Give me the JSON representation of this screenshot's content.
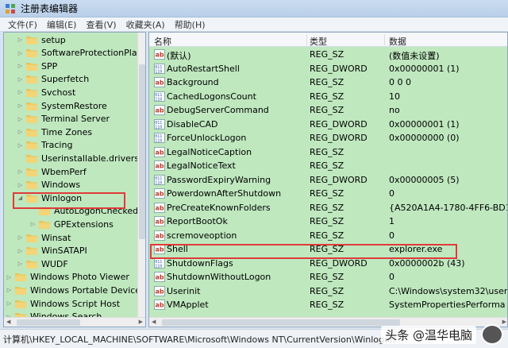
{
  "window": {
    "title": "注册表编辑器"
  },
  "menu": [
    "文件(F)",
    "编辑(E)",
    "查看(V)",
    "收藏夹(A)",
    "帮助(H)"
  ],
  "tree": {
    "items": [
      {
        "label": "setup",
        "indent": 1,
        "expander": "▷"
      },
      {
        "label": "SoftwareProtectionPlatform",
        "indent": 1,
        "expander": "▷"
      },
      {
        "label": "SPP",
        "indent": 1,
        "expander": "▷"
      },
      {
        "label": "Superfetch",
        "indent": 1,
        "expander": "▷"
      },
      {
        "label": "Svchost",
        "indent": 1,
        "expander": "▷"
      },
      {
        "label": "SystemRestore",
        "indent": 1,
        "expander": "▷"
      },
      {
        "label": "Terminal Server",
        "indent": 1,
        "expander": "▷"
      },
      {
        "label": "Time Zones",
        "indent": 1,
        "expander": "▷"
      },
      {
        "label": "Tracing",
        "indent": 1,
        "expander": "▷"
      },
      {
        "label": "Userinstallable.drivers",
        "indent": 1,
        "expander": ""
      },
      {
        "label": "WbemPerf",
        "indent": 1,
        "expander": "▷"
      },
      {
        "label": "Windows",
        "indent": 1,
        "expander": "▷"
      },
      {
        "label": "Winlogon",
        "indent": 1,
        "expander": "◢"
      },
      {
        "label": "AutoLogonChecked",
        "indent": 2,
        "expander": ""
      },
      {
        "label": "GPExtensions",
        "indent": 2,
        "expander": "▷"
      },
      {
        "label": "Winsat",
        "indent": 1,
        "expander": "▷"
      },
      {
        "label": "WinSATAPI",
        "indent": 1,
        "expander": "▷"
      },
      {
        "label": "WUDF",
        "indent": 1,
        "expander": "▷"
      },
      {
        "label": "Windows Photo Viewer",
        "indent": 0,
        "expander": "▷"
      },
      {
        "label": "Windows Portable Devices",
        "indent": 0,
        "expander": "▷"
      },
      {
        "label": "Windows Script Host",
        "indent": 0,
        "expander": "▷"
      },
      {
        "label": "Windows Search",
        "indent": 0,
        "expander": "▷"
      }
    ]
  },
  "list": {
    "columns": [
      "名称",
      "类型",
      "数据"
    ],
    "rows": [
      {
        "icon": "string-value-icon",
        "name": "(默认)",
        "type": "REG_SZ",
        "data": "(数值未设置)"
      },
      {
        "icon": "dword-value-icon",
        "name": "AutoRestartShell",
        "type": "REG_DWORD",
        "data": "0x00000001 (1)"
      },
      {
        "icon": "string-value-icon",
        "name": "Background",
        "type": "REG_SZ",
        "data": "0 0 0"
      },
      {
        "icon": "dword-value-icon",
        "name": "CachedLogonsCount",
        "type": "REG_SZ",
        "data": "10"
      },
      {
        "icon": "string-value-icon",
        "name": "DebugServerCommand",
        "type": "REG_SZ",
        "data": "no"
      },
      {
        "icon": "dword-value-icon",
        "name": "DisableCAD",
        "type": "REG_DWORD",
        "data": "0x00000001 (1)"
      },
      {
        "icon": "dword-value-icon",
        "name": "ForceUnlockLogon",
        "type": "REG_DWORD",
        "data": "0x00000000 (0)"
      },
      {
        "icon": "string-value-icon",
        "name": "LegalNoticeCaption",
        "type": "REG_SZ",
        "data": ""
      },
      {
        "icon": "string-value-icon",
        "name": "LegalNoticeText",
        "type": "REG_SZ",
        "data": ""
      },
      {
        "icon": "dword-value-icon",
        "name": "PasswordExpiryWarning",
        "type": "REG_DWORD",
        "data": "0x00000005 (5)"
      },
      {
        "icon": "string-value-icon",
        "name": "PowerdownAfterShutdown",
        "type": "REG_SZ",
        "data": "0"
      },
      {
        "icon": "string-value-icon",
        "name": "PreCreateKnownFolders",
        "type": "REG_SZ",
        "data": "{A520A1A4-1780-4FF6-BD1"
      },
      {
        "icon": "string-value-icon",
        "name": "ReportBootOk",
        "type": "REG_SZ",
        "data": "1"
      },
      {
        "icon": "string-value-icon",
        "name": "scremoveoption",
        "type": "REG_SZ",
        "data": "0"
      },
      {
        "icon": "string-value-icon",
        "name": "Shell",
        "type": "REG_SZ",
        "data": "explorer.exe"
      },
      {
        "icon": "dword-value-icon",
        "name": "ShutdownFlags",
        "type": "REG_DWORD",
        "data": "0x0000002b (43)"
      },
      {
        "icon": "string-value-icon",
        "name": "ShutdownWithoutLogon",
        "type": "REG_SZ",
        "data": "0"
      },
      {
        "icon": "string-value-icon",
        "name": "Userinit",
        "type": "REG_SZ",
        "data": "C:\\Windows\\system32\\user"
      },
      {
        "icon": "string-value-icon",
        "name": "VMApplet",
        "type": "REG_SZ",
        "data": "SystemPropertiesPerforma"
      }
    ]
  },
  "status": {
    "path": "计算机\\HKEY_LOCAL_MACHINE\\SOFTWARE\\Microsoft\\Windows NT\\CurrentVersion\\Winlogon"
  },
  "watermark": {
    "text": "头条 @温华电脑"
  },
  "colors": {
    "tree_bg": "#bfe8bf",
    "highlight_border": "#e03a3a"
  }
}
